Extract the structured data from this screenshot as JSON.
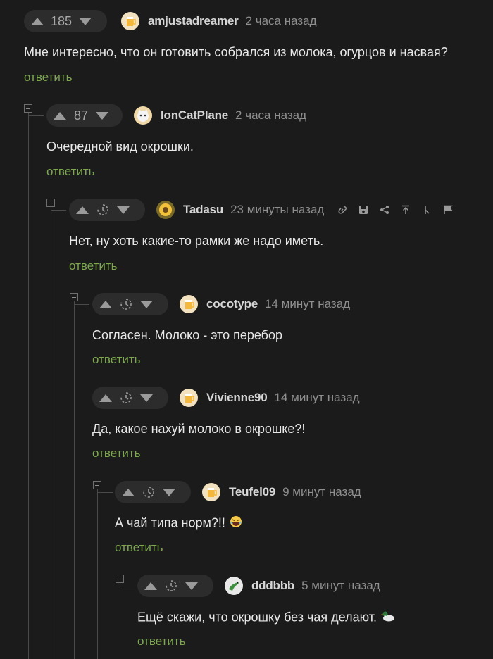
{
  "comments": [
    {
      "score": "185",
      "user": "amjustadreamer",
      "time": "2 часа назад",
      "text": "Мне интересно, что он готовить собрался из молока, огурцов и насвая?",
      "reply": "ответить",
      "avatar": "beer-avatar"
    },
    {
      "score": "87",
      "user": "IonCatPlane",
      "time": "2 часа назад",
      "text": "Очередной вид окрошки.",
      "reply": "ответить",
      "avatar": "cat-avatar"
    },
    {
      "user": "Tadasu",
      "time": "23 минуты назад",
      "text": "Нет, ну хоть какие-то рамки же надо иметь.",
      "reply": "ответить",
      "avatar": "sunflower-avatar"
    },
    {
      "user": "cocotype",
      "time": "14 минут назад",
      "text": "Согласен. Молоко - это перебор",
      "reply": "ответить",
      "avatar": "beer-avatar"
    },
    {
      "user": "Vivienne90",
      "time": "14 минут назад",
      "text": "Да, какое нахуй молоко в окрошке?!",
      "reply": "ответить",
      "avatar": "beer-avatar"
    },
    {
      "user": "Teufel09",
      "time": "9 минут назад",
      "text": "А чай типа норм?!!",
      "reply": "ответить",
      "avatar": "beer-avatar",
      "emoji": "laughing-emoji"
    },
    {
      "user": "dddbbb",
      "time": "5 минут назад",
      "text": "Ещё скажи, что окрошку без чая делают.",
      "reply": "ответить",
      "avatar": "lizard-avatar",
      "emoji": "duck-emoji"
    }
  ],
  "tools": [
    "link-icon",
    "save-icon",
    "share-icon",
    "go-to-parent-icon",
    "branch-icon",
    "report-flag-icon"
  ],
  "colors": {
    "background": "#1b1b1b",
    "reply": "#7da84f",
    "vote_bg": "#2c2c2c"
  }
}
